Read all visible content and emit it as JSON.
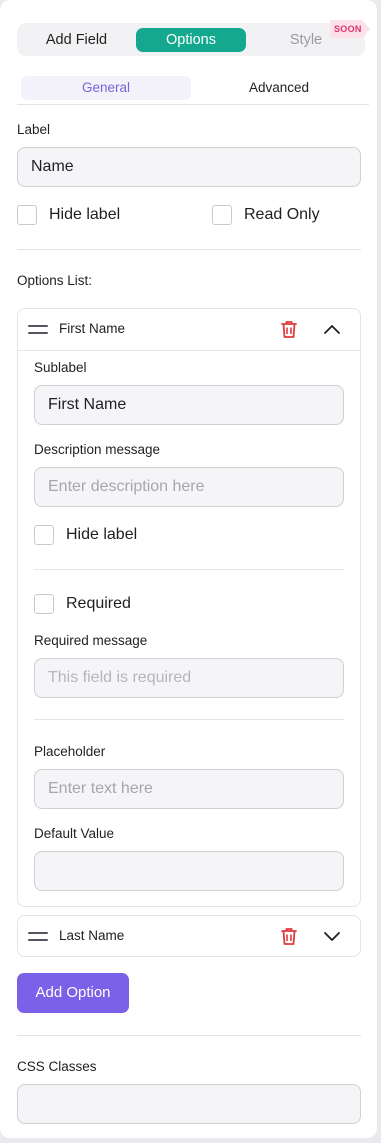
{
  "top_tabs": {
    "add_field": "Add Field",
    "options": "Options",
    "style": "Style",
    "soon_badge": "SOON"
  },
  "sub_tabs": {
    "general": "General",
    "advanced": "Advanced"
  },
  "label_section": {
    "label": "Label",
    "value": "Name",
    "hide_label": "Hide label",
    "read_only": "Read Only"
  },
  "options_list": {
    "title": "Options List:",
    "items": [
      {
        "name": "First Name",
        "expanded": true,
        "sublabel_label": "Sublabel",
        "sublabel_value": "First Name",
        "description_label": "Description message",
        "description_placeholder": "Enter description here",
        "hide_label": "Hide label",
        "required": "Required",
        "required_message_label": "Required message",
        "required_message_placeholder": "This field is required",
        "placeholder_label": "Placeholder",
        "placeholder_placeholder": "Enter text here",
        "default_value_label": "Default Value",
        "default_value": ""
      },
      {
        "name": "Last Name",
        "expanded": false
      }
    ],
    "add_option": "Add Option"
  },
  "css_classes": {
    "label": "CSS Classes",
    "value": ""
  },
  "colors": {
    "accent_teal": "#14a88e",
    "accent_purple": "#7b61e8",
    "delete_red": "#e03b3b"
  },
  "icons": {
    "drag": "drag-handle-icon",
    "delete": "trash-icon",
    "collapse": "chevron-up-icon",
    "expand": "chevron-down-icon"
  }
}
